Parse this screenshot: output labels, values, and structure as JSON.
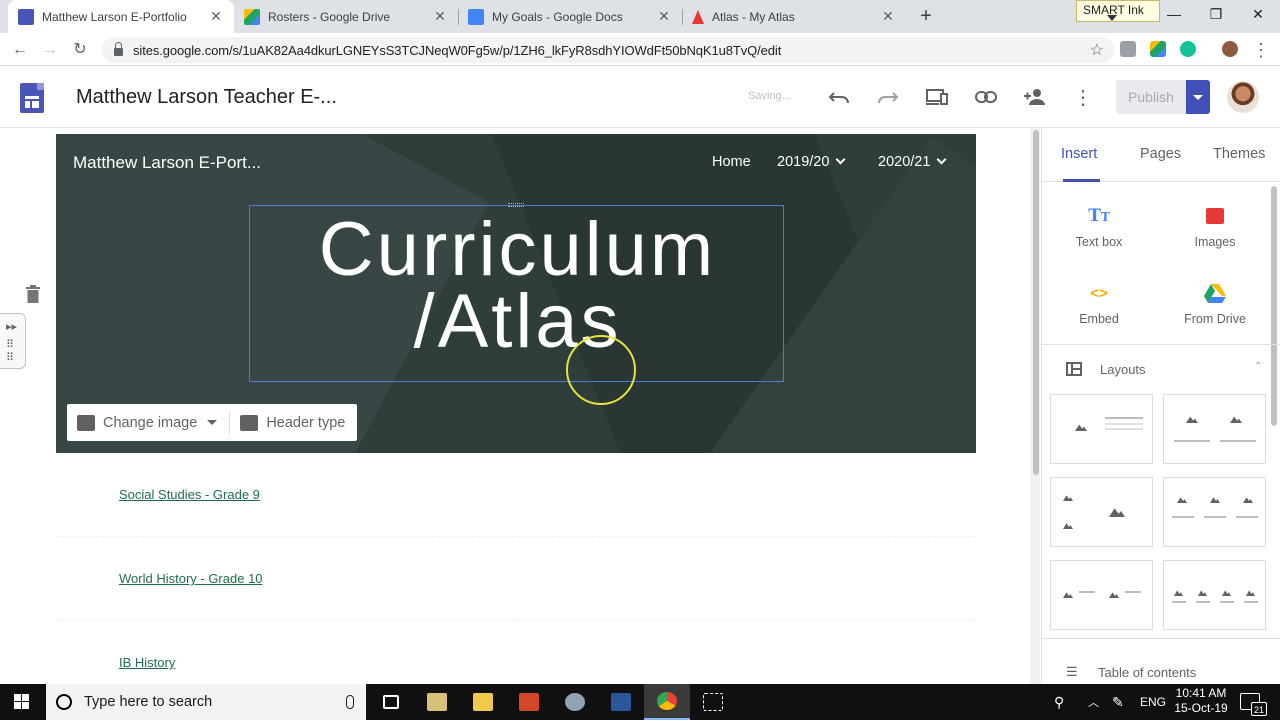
{
  "browser": {
    "tabs": [
      {
        "title": "Matthew Larson E-Portfolio",
        "favicon_color": "#4a56b7",
        "active": true
      },
      {
        "title": "Rosters - Google Drive",
        "favicon_color": "#1fa463",
        "active": false
      },
      {
        "title": "My Goals - Google Docs",
        "favicon_color": "#4285f4",
        "active": false
      },
      {
        "title": "Atlas - My Atlas",
        "favicon_color": "#e53935",
        "active": false
      }
    ],
    "smart_ink": "SMART Ink",
    "url": "sites.google.com/s/1uAK82Aa4dkurLGNEYsS3TCJNeqW0Fg5w/p/1ZH6_lkFyR8sdhYIOWdFt50bNqK1u8TvQ/edit"
  },
  "editor": {
    "doc_title": "Matthew Larson Teacher E-...",
    "saving_text": "Saving...",
    "publish_label": "Publish",
    "accent_color": "#4050b5"
  },
  "site": {
    "name": "Matthew Larson E-Port...",
    "nav": [
      {
        "label": "Home",
        "dropdown": false
      },
      {
        "label": "2019/20",
        "dropdown": true
      },
      {
        "label": "2020/21",
        "dropdown": true
      }
    ],
    "hero_title_line1": "Curriculum",
    "hero_title_line2": "/Atlas",
    "change_image_label": "Change image",
    "header_type_label": "Header type",
    "links": [
      "Social Studies - Grade 9",
      "World History - Grade 10",
      "IB History"
    ]
  },
  "panel": {
    "tabs": [
      "Insert",
      "Pages",
      "Themes"
    ],
    "insert_items": [
      {
        "label": "Text box",
        "icon": "text-box-icon"
      },
      {
        "label": "Images",
        "icon": "image-icon"
      },
      {
        "label": "Embed",
        "icon": "embed-icon"
      },
      {
        "label": "From Drive",
        "icon": "drive-icon"
      }
    ],
    "layouts_label": "Layouts",
    "toc_label": "Table of contents"
  },
  "taskbar": {
    "search_placeholder": "Type here to search",
    "language": "ENG",
    "time": "10:41 AM",
    "date": "15-Oct-19",
    "notification_count": "21"
  }
}
